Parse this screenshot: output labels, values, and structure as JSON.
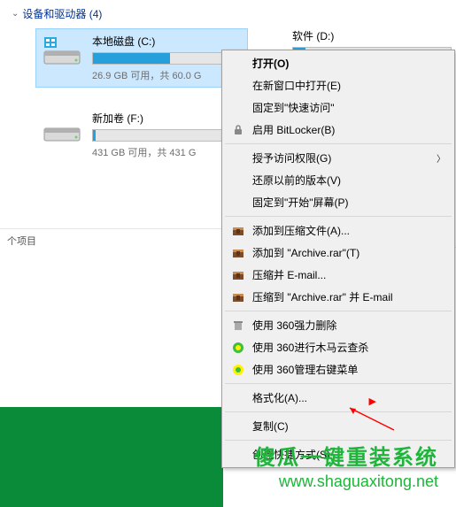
{
  "section": {
    "label": "设备和驱动器 (4)"
  },
  "drives": {
    "c": {
      "name": "本地磁盘 (C:)",
      "space": "26.9 GB 可用，共 60.0 G",
      "fill_pct": 55
    },
    "d": {
      "name": "软件 (D:)",
      "fill_pct": 8
    },
    "f": {
      "name": "新加卷 (F:)",
      "space": "431 GB 可用，共 431 G",
      "fill_pct": 2
    }
  },
  "status": "个项目",
  "menu": {
    "open": "打开(O)",
    "open_new": "在新窗口中打开(E)",
    "pin_quick": "固定到\"快速访问\"",
    "bitlocker": "启用 BitLocker(B)",
    "access": "授予访问权限(G)",
    "restore": "还原以前的版本(V)",
    "pin_start": "固定到\"开始\"屏幕(P)",
    "add_archive": "添加到压缩文件(A)...",
    "add_rar": "添加到 \"Archive.rar\"(T)",
    "compress_email": "压缩并 E-mail...",
    "compress_rar_email": "压缩到 \"Archive.rar\" 并 E-mail",
    "force_del": "使用 360强力删除",
    "trojan": "使用 360进行木马云查杀",
    "menu_mgr": "使用 360管理右键菜单",
    "format": "格式化(A)...",
    "copy": "复制(C)",
    "shortcut": "创建快捷方式(S)"
  },
  "watermark": {
    "line1": "傻瓜一键重装系统",
    "line2": "www.shaguaxitong.net"
  }
}
